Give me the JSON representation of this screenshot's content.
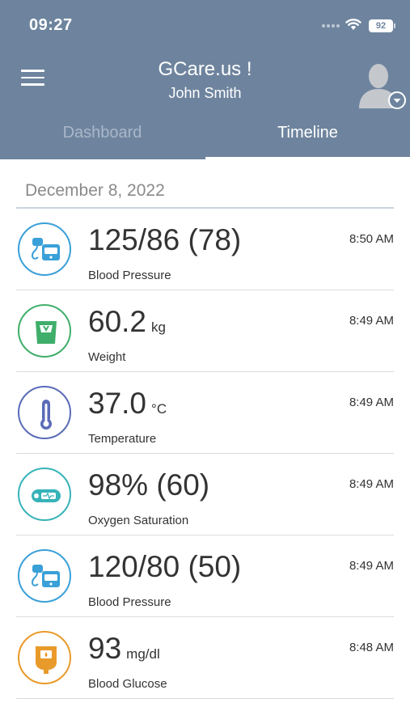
{
  "status_bar": {
    "time": "09:27",
    "battery": "92"
  },
  "header": {
    "title": "GCare.us !",
    "subtitle": "John Smith"
  },
  "tabs": [
    {
      "label": "Dashboard",
      "active": false
    },
    {
      "label": "Timeline",
      "active": true
    }
  ],
  "timeline": {
    "date": "December 8, 2022",
    "entries": [
      {
        "icon": "blood-pressure-icon",
        "color": "#3aa0d8",
        "value": "125/86 (78)",
        "unit": "",
        "label": "Blood Pressure",
        "time": "8:50 AM"
      },
      {
        "icon": "weight-scale-icon",
        "color": "#3fae6a",
        "value": "60.2",
        "unit": "kg",
        "label": "Weight",
        "time": "8:49 AM"
      },
      {
        "icon": "thermometer-icon",
        "color": "#5a6bb8",
        "value": "37.0",
        "unit": "°C",
        "label": "Temperature",
        "time": "8:49 AM"
      },
      {
        "icon": "pulse-oximeter-icon",
        "color": "#36b3b8",
        "value": "98% (60)",
        "unit": "",
        "label": "Oxygen Saturation",
        "time": "8:49 AM"
      },
      {
        "icon": "blood-pressure-icon",
        "color": "#3aa0d8",
        "value": "120/80 (50)",
        "unit": "",
        "label": "Blood Pressure",
        "time": "8:49 AM"
      },
      {
        "icon": "glucometer-icon",
        "color": "#e89a2a",
        "value": "93",
        "unit": "mg/dl",
        "label": "Blood Glucose",
        "time": "8:48 AM"
      }
    ]
  }
}
